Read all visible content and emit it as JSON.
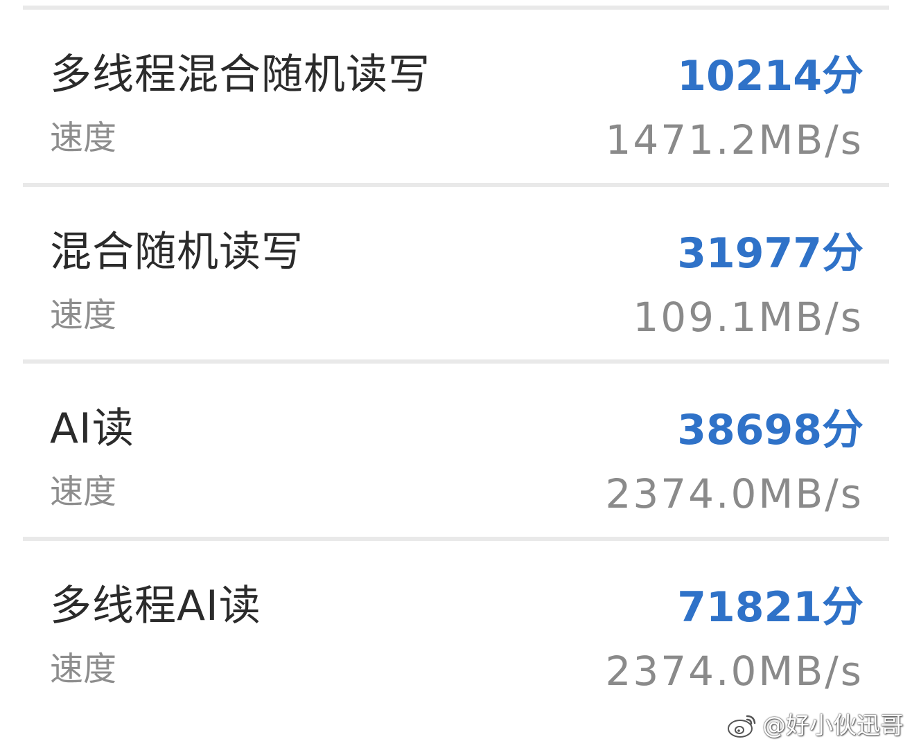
{
  "rows": [
    {
      "title": "多线程混合随机读写",
      "score": "10214分",
      "speed_label": "速度",
      "speed": "1471.2MB/s"
    },
    {
      "title": "混合随机读写",
      "score": "31977分",
      "speed_label": "速度",
      "speed": "109.1MB/s"
    },
    {
      "title": "AI读",
      "score": "38698分",
      "speed_label": "速度",
      "speed": "2374.0MB/s"
    },
    {
      "title": "多线程AI读",
      "score": "71821分",
      "speed_label": "速度",
      "speed": "2374.0MB/s"
    }
  ],
  "watermark": {
    "text": "@好小伙迅哥",
    "icon": "weibo-icon"
  },
  "colors": {
    "score": "#2f72c8",
    "title": "#2b2b2b",
    "secondary": "#8a8a8a",
    "divider": "#e9e9e9"
  }
}
